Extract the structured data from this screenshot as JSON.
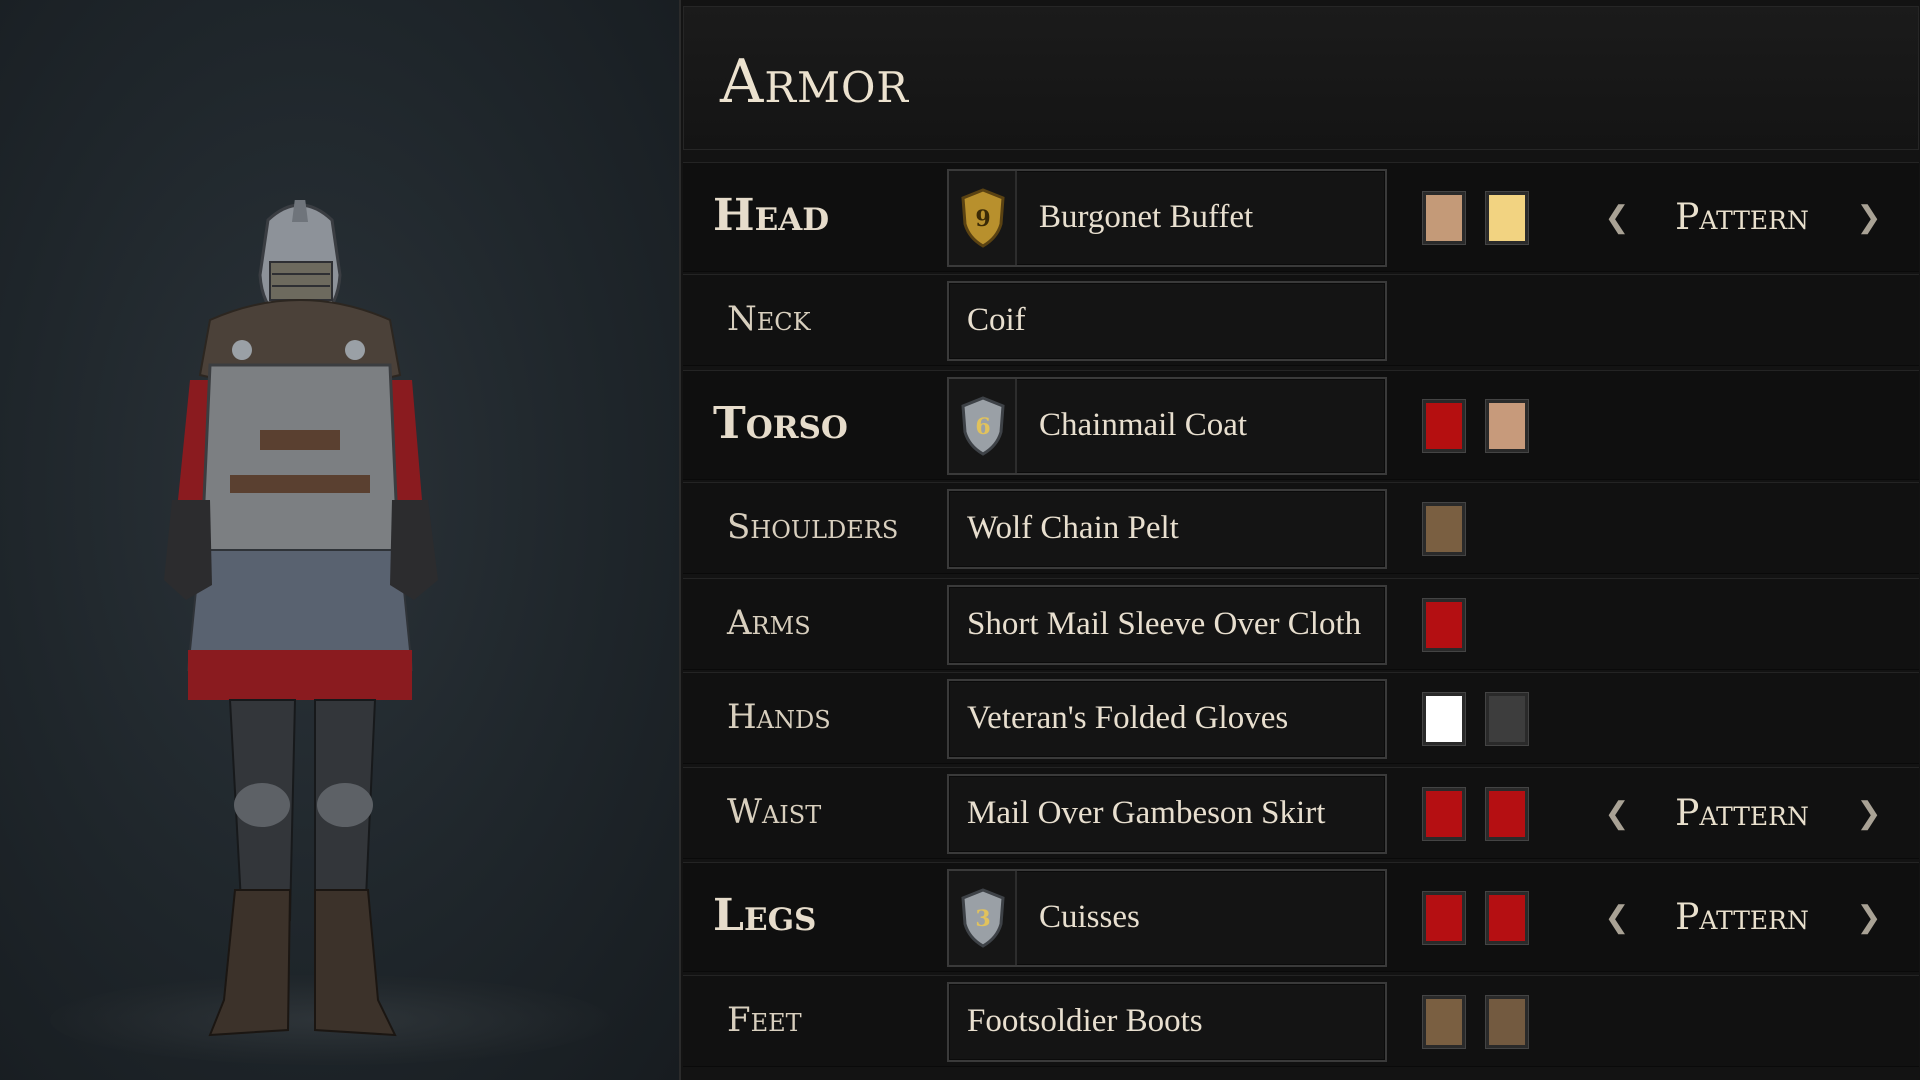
{
  "panel": {
    "title": "Armor"
  },
  "slots": [
    {
      "label": "Head",
      "major": true,
      "tier": "9",
      "tier_style": "gold",
      "item": "Burgonet Buffet",
      "colors": [
        "#c49a78",
        "#f2d381"
      ],
      "pattern": "Pattern"
    },
    {
      "label": "Neck",
      "major": false,
      "item": "Coif",
      "colors": []
    },
    {
      "label": "Torso",
      "major": true,
      "tier": "6",
      "tier_style": "silver",
      "item": "Chainmail Coat",
      "colors": [
        "#b50f10",
        "#c79a7b"
      ]
    },
    {
      "label": "Shoulders",
      "major": false,
      "item": "Wolf Chain Pelt",
      "colors": [
        "#7a5f41"
      ]
    },
    {
      "label": "Arms",
      "major": false,
      "item": "Short Mail Sleeve Over Cloth",
      "colors": [
        "#b40f12"
      ]
    },
    {
      "label": "Hands",
      "major": false,
      "item": "Veteran's Folded Gloves",
      "colors": [
        "#ffffff",
        "#3d3d3d"
      ]
    },
    {
      "label": "Waist",
      "major": false,
      "item": "Mail Over Gambeson Skirt",
      "colors": [
        "#b50f12",
        "#b50f12"
      ],
      "pattern": "Pattern"
    },
    {
      "label": "Legs",
      "major": true,
      "tier": "3",
      "tier_style": "silver",
      "item": "Cuisses",
      "colors": [
        "#b50f12",
        "#b50f12"
      ],
      "pattern": "Pattern"
    },
    {
      "label": "Feet",
      "major": false,
      "item": "Footsoldier Boots",
      "colors": [
        "#7a5f41",
        "#735a40"
      ]
    }
  ],
  "icons": {
    "prev": "chevron-left-icon",
    "next": "chevron-right-icon",
    "tier": "shield-icon"
  }
}
